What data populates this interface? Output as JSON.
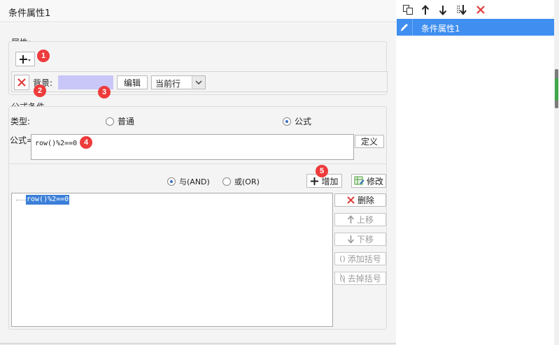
{
  "window": {
    "title": "条件属性1"
  },
  "attributes": {
    "section_label": "属性:",
    "background_label": "背景:",
    "background_color": "#c9c7f7",
    "edit_button": "编辑",
    "scope_select": "当前行"
  },
  "formula_condition": {
    "section_label": "公式条件",
    "type_label": "类型:",
    "option_normal": "普通",
    "option_formula": "公式",
    "selected_type": "公式",
    "formula_label": "公式=",
    "formula_value": "row()%2==0",
    "define_button": "定义"
  },
  "logic": {
    "and_label": "与(AND)",
    "or_label": "或(OR)",
    "selected": "与(AND)",
    "add_button": "增加",
    "modify_button": "修改"
  },
  "condition_list": {
    "items": [
      "row()%2==0"
    ]
  },
  "side_buttons": {
    "delete": "删除",
    "move_up": "上移",
    "move_down": "下移",
    "add_brackets": "添加括号",
    "remove_brackets": "去掉括号"
  },
  "badges": [
    "1",
    "2",
    "3",
    "4",
    "5"
  ],
  "right_panel": {
    "items": [
      {
        "label": "条件属性1",
        "selected": true
      }
    ]
  },
  "colors": {
    "accent": "#3f8ef0",
    "selection": "#3b7fd9",
    "badge": "#ee3b3b",
    "delete_red": "#e23b3b"
  }
}
